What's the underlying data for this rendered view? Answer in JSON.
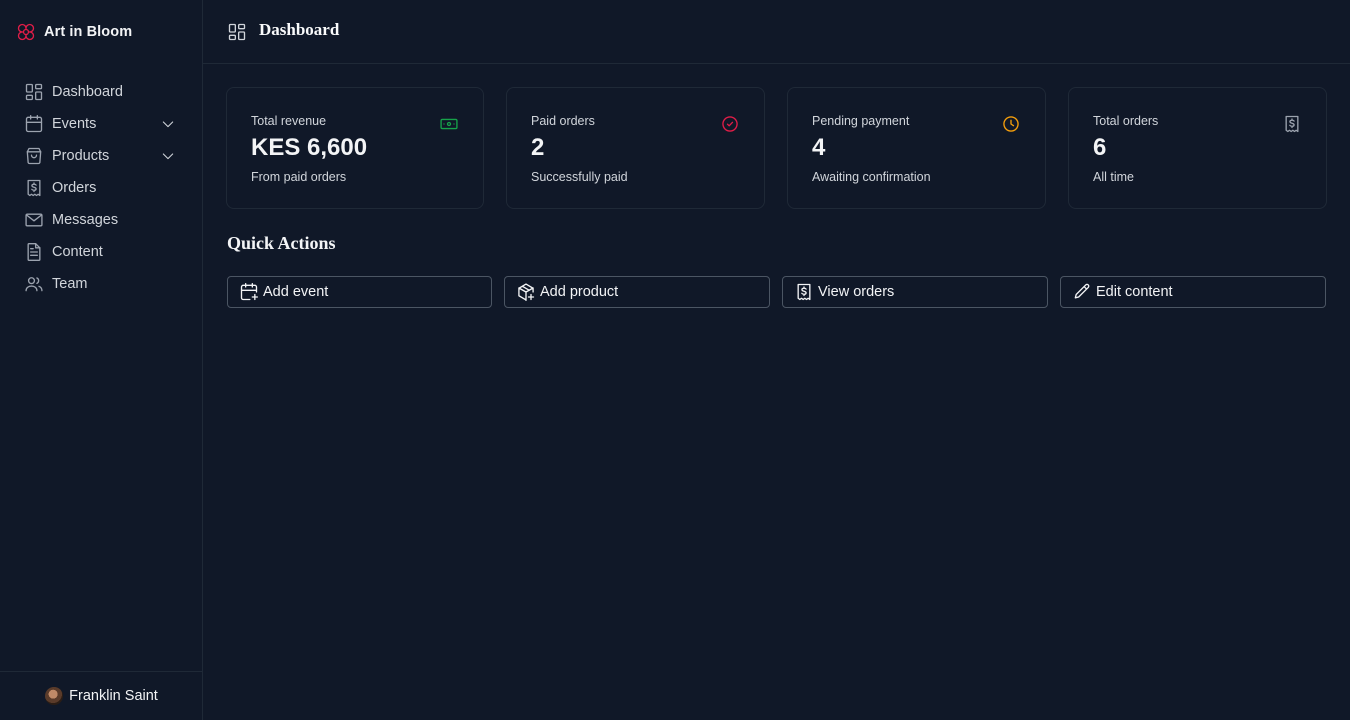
{
  "brand": {
    "name": "Art in Bloom",
    "icon": "flower-icon",
    "color": "#e11d48"
  },
  "sidebar": {
    "items": [
      {
        "label": "Dashboard",
        "icon": "dashboard-icon",
        "expandable": false
      },
      {
        "label": "Events",
        "icon": "calendar-icon",
        "expandable": true
      },
      {
        "label": "Products",
        "icon": "shopping-bag-icon",
        "expandable": true
      },
      {
        "label": "Orders",
        "icon": "receipt-icon",
        "expandable": false
      },
      {
        "label": "Messages",
        "icon": "mail-icon",
        "expandable": false
      },
      {
        "label": "Content",
        "icon": "document-icon",
        "expandable": false
      },
      {
        "label": "Team",
        "icon": "users-icon",
        "expandable": false
      }
    ],
    "user": {
      "name": "Franklin Saint"
    }
  },
  "header": {
    "title": "Dashboard",
    "icon": "dashboard-icon"
  },
  "stats": [
    {
      "label": "Total revenue",
      "value": "KES 6,600",
      "sub": "From paid orders",
      "icon": "banknote-icon",
      "color": "#16a34a"
    },
    {
      "label": "Paid orders",
      "value": "2",
      "sub": "Successfully paid",
      "icon": "check-circle-icon",
      "color": "#e11d48"
    },
    {
      "label": "Pending payment",
      "value": "4",
      "sub": "Awaiting confirmation",
      "icon": "clock-icon",
      "color": "#f59e0b"
    },
    {
      "label": "Total orders",
      "value": "6",
      "sub": "All time",
      "icon": "receipt-icon",
      "color": "#9ca3af"
    }
  ],
  "quick_actions": {
    "title": "Quick Actions",
    "items": [
      {
        "label": "Add event",
        "icon": "calendar-plus-icon"
      },
      {
        "label": "Add product",
        "icon": "package-plus-icon"
      },
      {
        "label": "View orders",
        "icon": "receipt-icon"
      },
      {
        "label": "Edit content",
        "icon": "pencil-icon"
      }
    ]
  }
}
